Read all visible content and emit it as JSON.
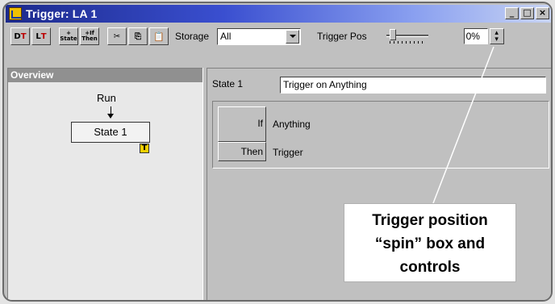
{
  "window": {
    "title": "Trigger: LA 1",
    "controls": [
      "_",
      "□",
      "×"
    ]
  },
  "toolbar": {
    "buttons": [
      {
        "name": "insert-trigger-before",
        "label": "D",
        "sub": "T"
      },
      {
        "name": "insert-trigger-after",
        "label": "L",
        "sub": "T"
      },
      {
        "name": "add-state",
        "top": "+",
        "bottom": "State"
      },
      {
        "name": "add-if-then",
        "top": "+If",
        "bottom": "Then"
      },
      {
        "name": "cut",
        "label": "✂"
      },
      {
        "name": "copy",
        "label": "⎘"
      },
      {
        "name": "paste",
        "label": "📋"
      }
    ],
    "storage_label": "Storage",
    "storage_value": "All",
    "trigger_pos_label": "Trigger Pos",
    "trigger_pos_value": "0%",
    "slider_fraction": 0.0
  },
  "overview": {
    "title": "Overview",
    "run_label": "Run",
    "state_label": "State 1",
    "trigger_marker": "T"
  },
  "editor": {
    "state_name": "State 1",
    "state_description": "Trigger on Anything",
    "if_label": "If",
    "if_condition": "Anything",
    "then_label": "Then",
    "then_action": "Trigger"
  },
  "callout": {
    "lines": [
      "Trigger position",
      "“spin” box and",
      "controls"
    ]
  }
}
